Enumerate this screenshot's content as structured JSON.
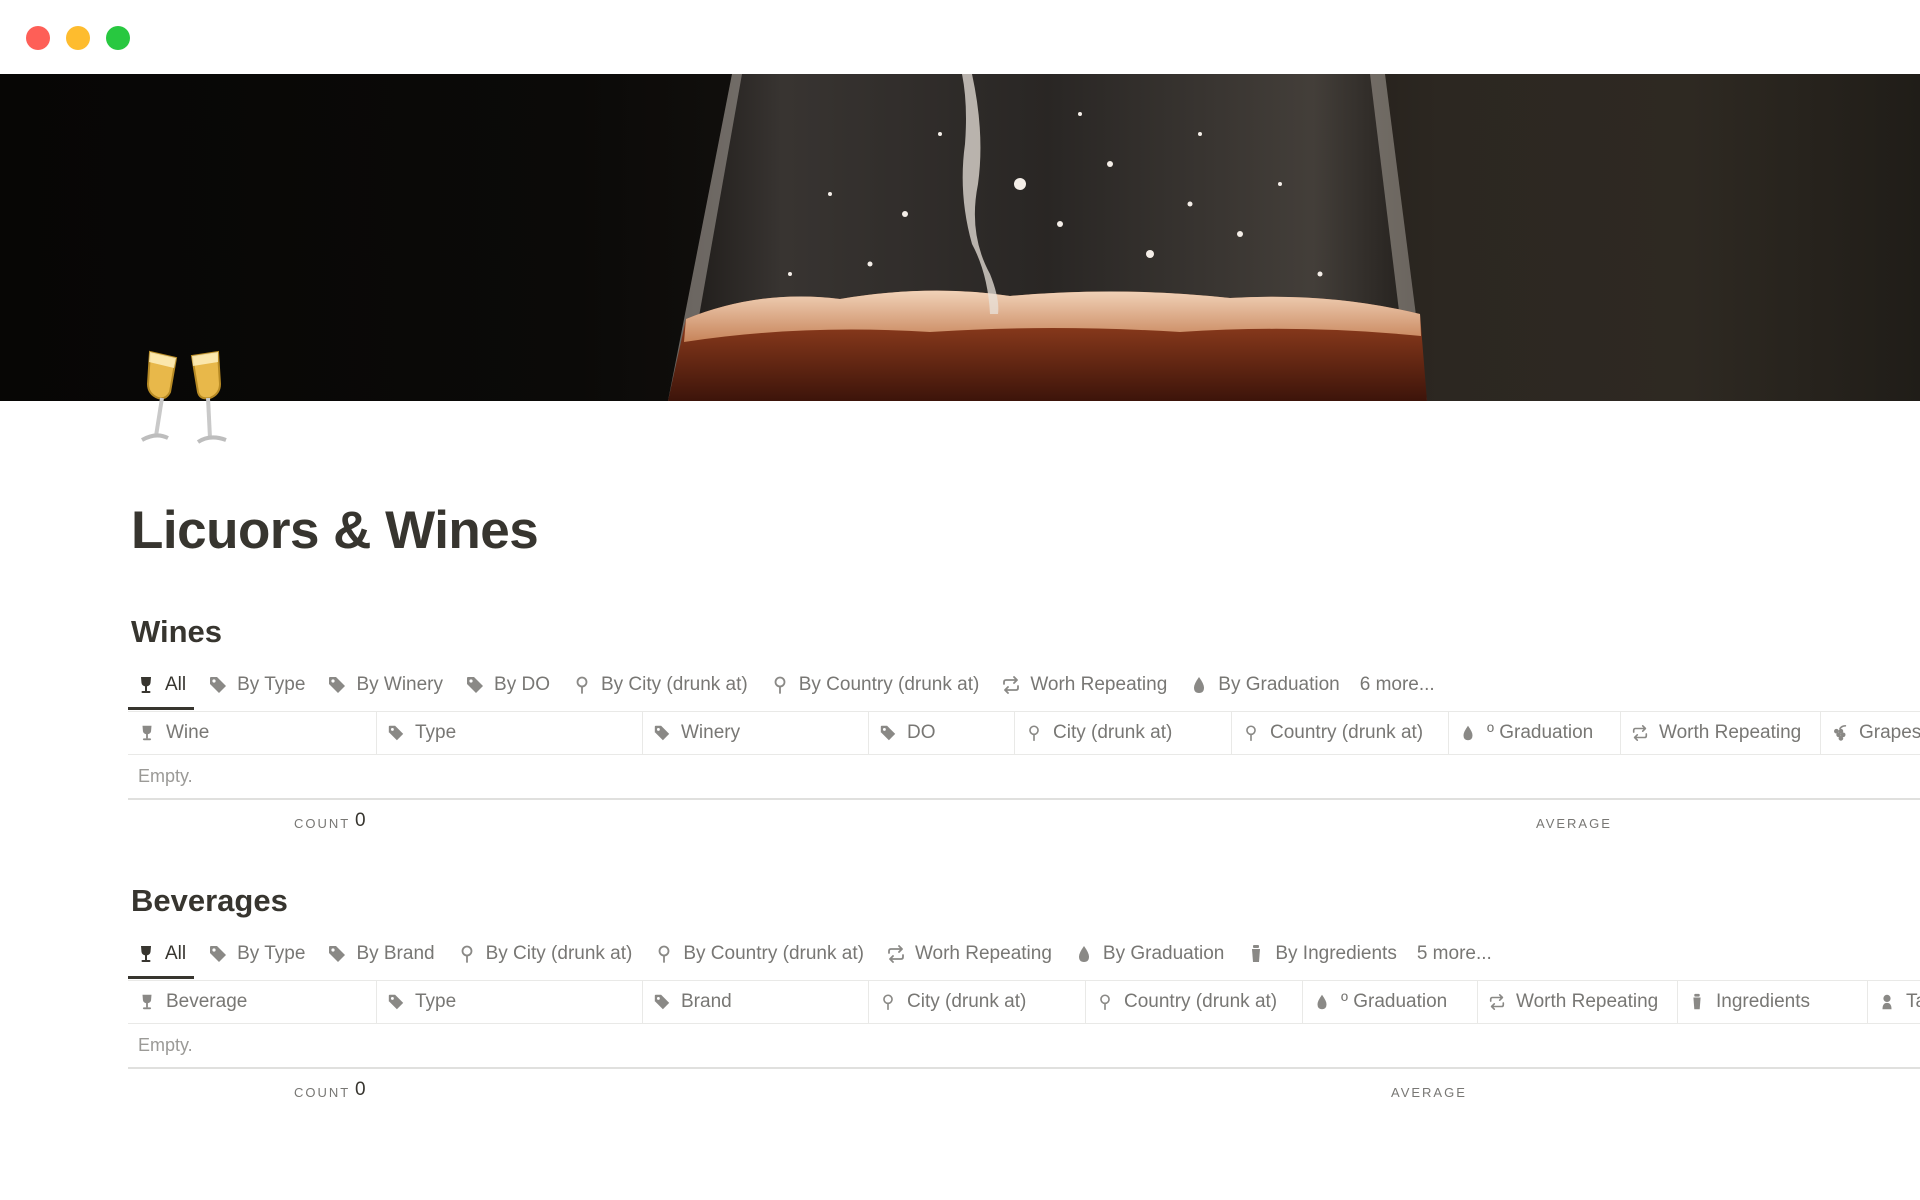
{
  "page": {
    "title": "Licuors & Wines",
    "icon": "clinking-glasses-icon",
    "cover": "wine-glass-photo"
  },
  "window": {
    "controls": [
      "close",
      "minimize",
      "maximize"
    ]
  },
  "wines": {
    "title": "Wines",
    "tabs": [
      {
        "label": "All",
        "icon": "wine-glass-icon",
        "active": true
      },
      {
        "label": "By Type",
        "icon": "tag-icon"
      },
      {
        "label": "By Winery",
        "icon": "tag-icon"
      },
      {
        "label": "By DO",
        "icon": "tag-icon"
      },
      {
        "label": "By City (drunk at)",
        "icon": "pin-icon"
      },
      {
        "label": "By Country (drunk at)",
        "icon": "pin-icon"
      },
      {
        "label": "Worh Repeating",
        "icon": "repeat-icon"
      },
      {
        "label": "By Graduation",
        "icon": "drop-icon"
      },
      {
        "label": "6 more..."
      }
    ],
    "columns": [
      {
        "label": "Wine",
        "icon": "wine-glass-icon"
      },
      {
        "label": "Type",
        "icon": "tag-icon"
      },
      {
        "label": "Winery",
        "icon": "tag-icon"
      },
      {
        "label": "DO",
        "icon": "tag-icon"
      },
      {
        "label": "City (drunk at)",
        "icon": "pin-icon"
      },
      {
        "label": "Country (drunk at)",
        "icon": "pin-icon"
      },
      {
        "label": "º Graduation",
        "icon": "drop-icon"
      },
      {
        "label": "Worth Repeating",
        "icon": "repeat-icon"
      },
      {
        "label": "Grapes",
        "icon": "grapes-icon"
      }
    ],
    "empty_text": "Empty.",
    "count_label": "COUNT",
    "count_value": "0",
    "average_label": "AVERAGE"
  },
  "beverages": {
    "title": "Beverages",
    "tabs": [
      {
        "label": "All",
        "icon": "wine-glass-icon",
        "active": true
      },
      {
        "label": "By Type",
        "icon": "tag-icon"
      },
      {
        "label": "By Brand",
        "icon": "tag-icon"
      },
      {
        "label": "By City (drunk at)",
        "icon": "pin-icon"
      },
      {
        "label": "By Country (drunk at)",
        "icon": "pin-icon"
      },
      {
        "label": "Worh Repeating",
        "icon": "repeat-icon"
      },
      {
        "label": "By Graduation",
        "icon": "drop-icon"
      },
      {
        "label": "By Ingredients",
        "icon": "shaker-icon"
      },
      {
        "label": "5 more..."
      }
    ],
    "columns": [
      {
        "label": "Beverage",
        "icon": "wine-glass-icon"
      },
      {
        "label": "Type",
        "icon": "tag-icon"
      },
      {
        "label": "Brand",
        "icon": "tag-icon"
      },
      {
        "label": "City (drunk at)",
        "icon": "pin-icon"
      },
      {
        "label": "Country (drunk at)",
        "icon": "pin-icon"
      },
      {
        "label": "º Graduation",
        "icon": "drop-icon"
      },
      {
        "label": "Worth Repeating",
        "icon": "repeat-icon"
      },
      {
        "label": "Ingredients",
        "icon": "shaker-icon"
      },
      {
        "label": "Ta",
        "icon": "tasting-icon"
      }
    ],
    "empty_text": "Empty.",
    "count_label": "COUNT",
    "count_value": "0",
    "average_label": "AVERAGE"
  }
}
